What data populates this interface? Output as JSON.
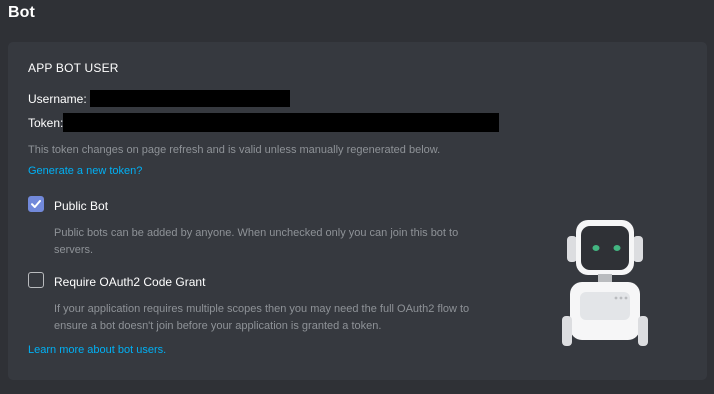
{
  "page": {
    "title": "Bot"
  },
  "section": {
    "title": "APP BOT USER"
  },
  "fields": {
    "username_label": "Username:",
    "token_label": "Token:"
  },
  "token_hint": "This token changes on page refresh and is valid unless manually regenerated below.",
  "regenerate_link": "Generate a new token?",
  "public_bot": {
    "label": "Public Bot",
    "checked": true,
    "description_line1": "Public bots can be added by anyone. When unchecked only you can join this bot to",
    "description_line2": "servers."
  },
  "oauth_grant": {
    "label": "Require OAuth2 Code Grant",
    "checked": false,
    "description_line1": "If your application requires multiple scopes then you may need the full OAuth2 flow to",
    "description_line2": "ensure a bot doesn't join before your application is granted a token."
  },
  "learn_more_link": "Learn more about bot users.",
  "colors": {
    "background": "#2f3136",
    "card": "#36393f",
    "accent": "#7289da",
    "link": "#00b0f4"
  },
  "icons": {
    "checkbox_checked": "check-icon",
    "mascot": "robot-mascot-illustration"
  }
}
